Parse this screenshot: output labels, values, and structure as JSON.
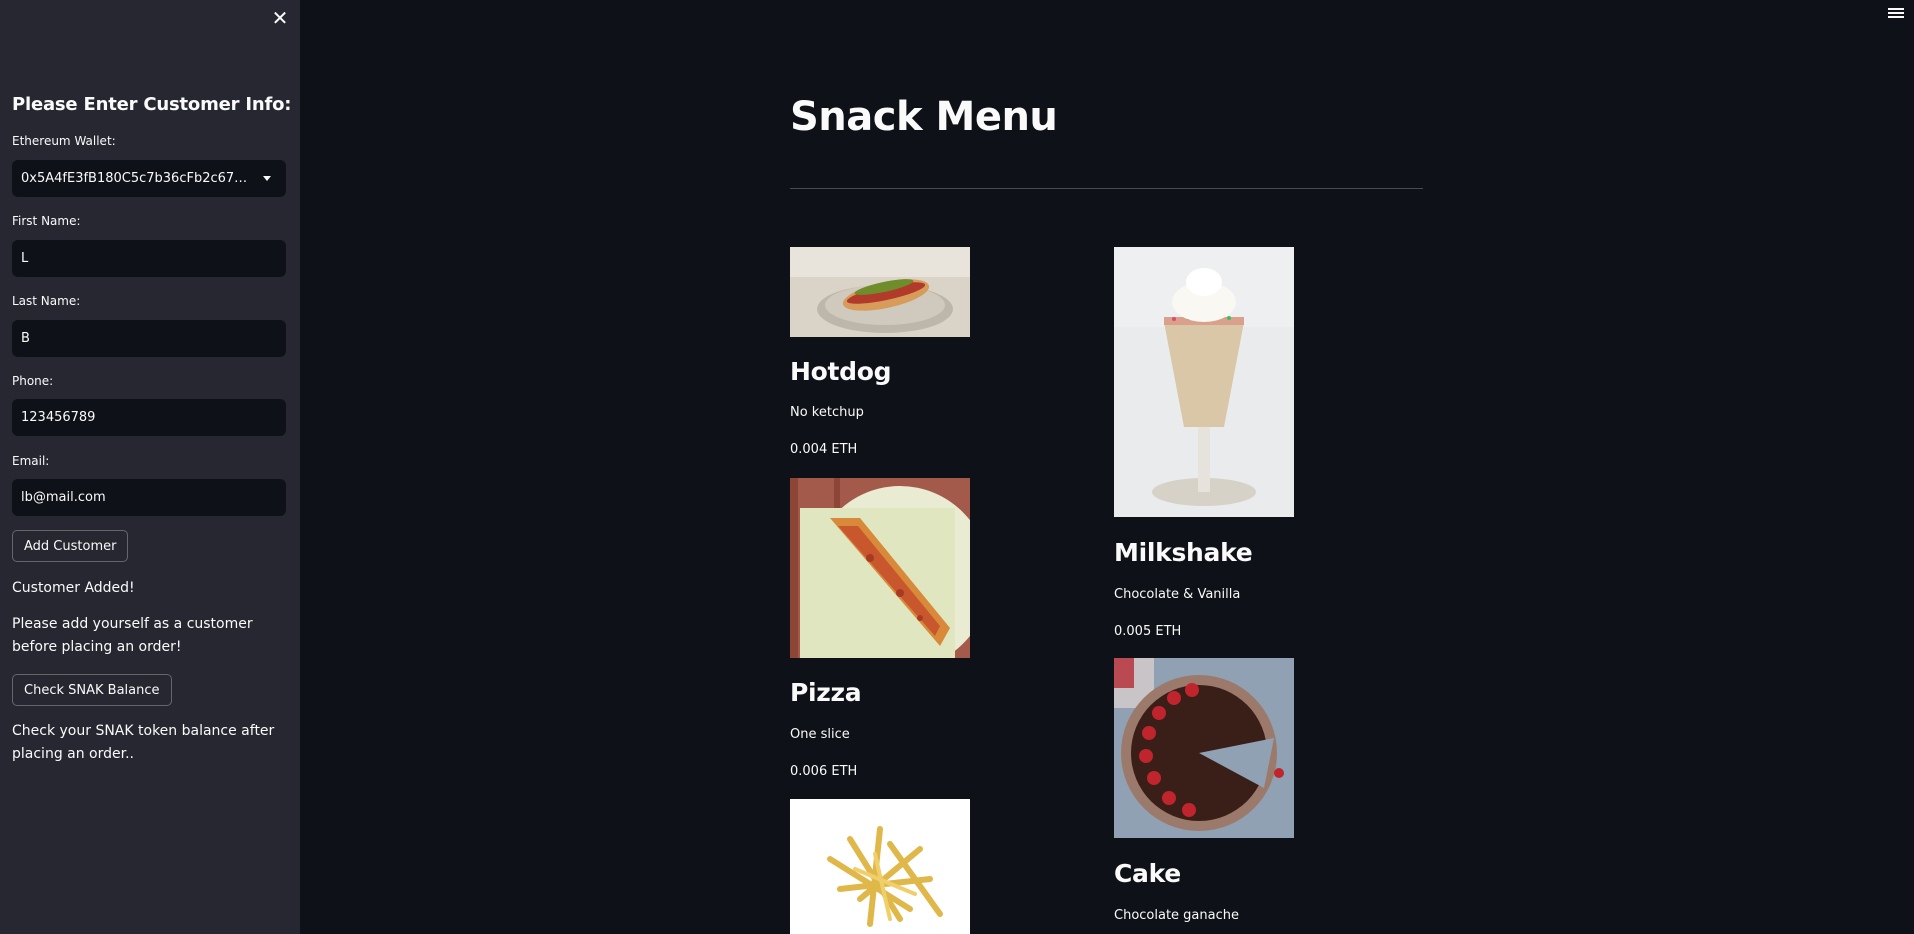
{
  "sidebar": {
    "title": "Please Enter Customer Info:",
    "wallet_label": "Ethereum Wallet:",
    "wallet_value": "0x5A4fE3fB180C5c7b36cFb2c67b99…",
    "first_name_label": "First Name:",
    "first_name_value": "L",
    "last_name_label": "Last Name:",
    "last_name_value": "B",
    "phone_label": "Phone:",
    "phone_value": "123456789",
    "email_label": "Email:",
    "email_value": "lb@mail.com",
    "add_customer_button": "Add Customer",
    "customer_added_text": "Customer Added!",
    "add_yourself_text": "Please add yourself as a customer before placing an order!",
    "check_balance_button": "Check SNAK Balance",
    "check_balance_text": "Check your SNAK token balance after placing an order.."
  },
  "main": {
    "title": "Snack Menu",
    "items": [
      {
        "name": "Hotdog",
        "description": "No ketchup",
        "price": "0.004 ETH",
        "image": "hotdog-image"
      },
      {
        "name": "Milkshake",
        "description": "Chocolate & Vanilla",
        "price": "0.005 ETH",
        "image": "milkshake-image"
      },
      {
        "name": "Pizza",
        "description": "One slice",
        "price": "0.006 ETH",
        "image": "pizza-image"
      },
      {
        "name": "Cake",
        "description": "Chocolate ganache",
        "price": "",
        "image": "cake-image"
      },
      {
        "name": "",
        "description": "",
        "price": "",
        "image": "fries-image"
      }
    ]
  },
  "icons": {
    "close": "close-icon",
    "menu": "hamburger-menu-icon",
    "dropdown": "chevron-down-icon"
  },
  "colors": {
    "background": "#0e1117",
    "sidebar": "#262730",
    "text": "#fafafa"
  }
}
